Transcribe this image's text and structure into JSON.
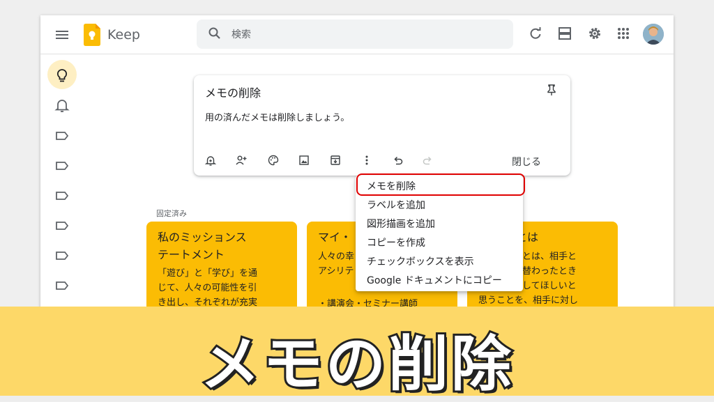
{
  "app": {
    "title": "Keep"
  },
  "search": {
    "placeholder": "検索"
  },
  "note": {
    "title": "メモの削除",
    "body": "用の済んだメモは削除しましょう。",
    "close_label": "閉じる"
  },
  "menu": {
    "items": [
      "メモを削除",
      "ラベルを追加",
      "図形描画を追加",
      "コピーを作成",
      "チェックボックスを表示",
      "Google ドキュメントにコピー"
    ]
  },
  "pinned": {
    "label": "固定済み"
  },
  "cards": [
    {
      "title_lines": [
        "私のミッションス",
        "テートメント"
      ],
      "text_lines": [
        "「遊び」と「学び」を通",
        "じて、人々の可能性を引",
        "き出し、それぞれが充実"
      ]
    },
    {
      "title_lines": [
        "マイ・"
      ],
      "text_lines": [
        "人々の幸",
        "アシリテ",
        "・講演会・セミナー講師"
      ]
    },
    {
      "title_lines": [
        "とは"
      ],
      "text_lines": [
        "」とは、相手と",
        "れ替わったとき",
        "がしてほしいと",
        "思うことを、相手に対し"
      ]
    }
  ],
  "banner": {
    "title": "メモの削除"
  },
  "colors": {
    "accent": "#fbbc04",
    "highlight": "#e00000",
    "banner": "#fdd868",
    "active_nav": "#feefc3"
  }
}
